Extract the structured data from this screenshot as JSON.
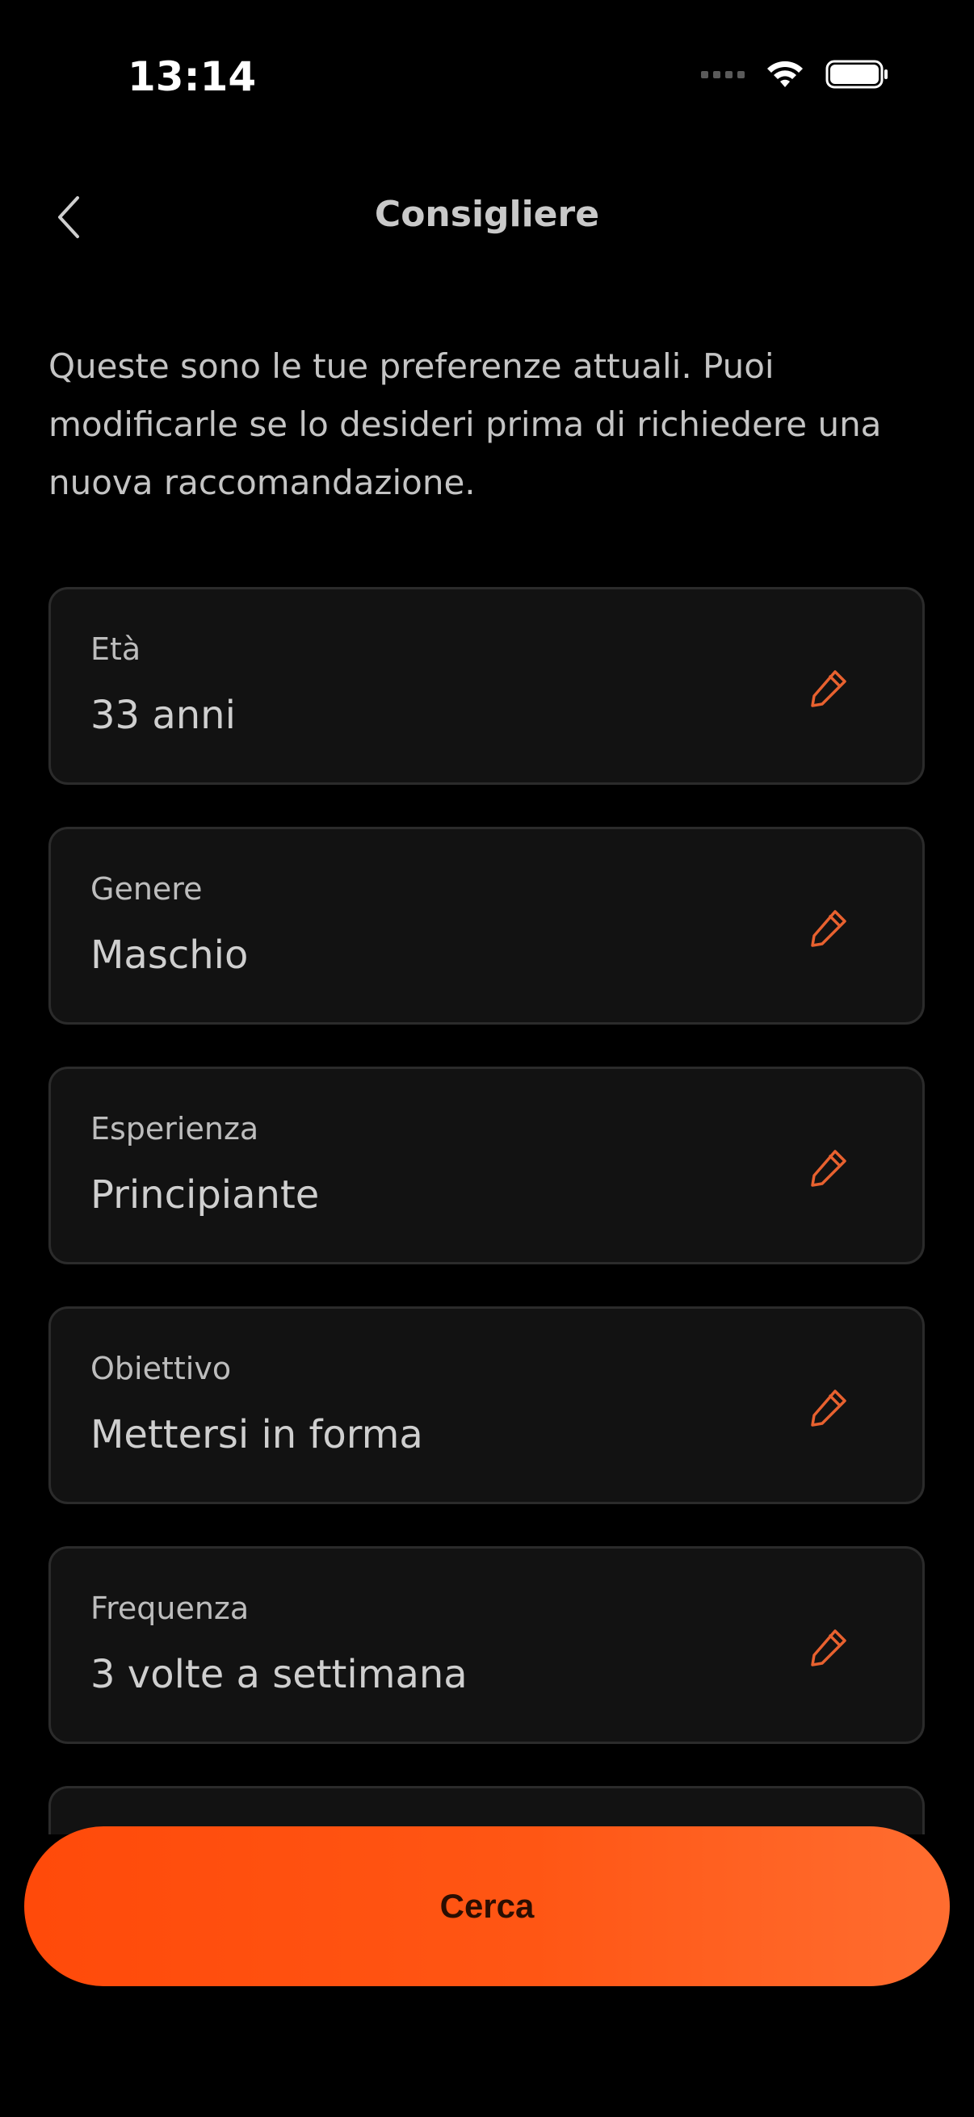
{
  "status_bar": {
    "time": "13:14"
  },
  "header": {
    "title": "Consigliere",
    "back_icon": "chevron-left-icon"
  },
  "intro": {
    "text": "Queste sono le tue preferenze attuali. Puoi modificarle se lo desideri prima di richiedere una nuova raccomandazione."
  },
  "preferences": [
    {
      "label": "Età",
      "value": "33 anni"
    },
    {
      "label": "Genere",
      "value": "Maschio"
    },
    {
      "label": "Esperienza",
      "value": "Principiante"
    },
    {
      "label": "Obiettivo",
      "value": "Mettersi in forma"
    },
    {
      "label": "Frequenza",
      "value": "3 volte a settimana"
    }
  ],
  "action": {
    "search_label": "Cerca"
  },
  "colors": {
    "background": "#000000",
    "card": "#121212",
    "accent": "#ff5614",
    "edit_icon": "#e8612f"
  }
}
